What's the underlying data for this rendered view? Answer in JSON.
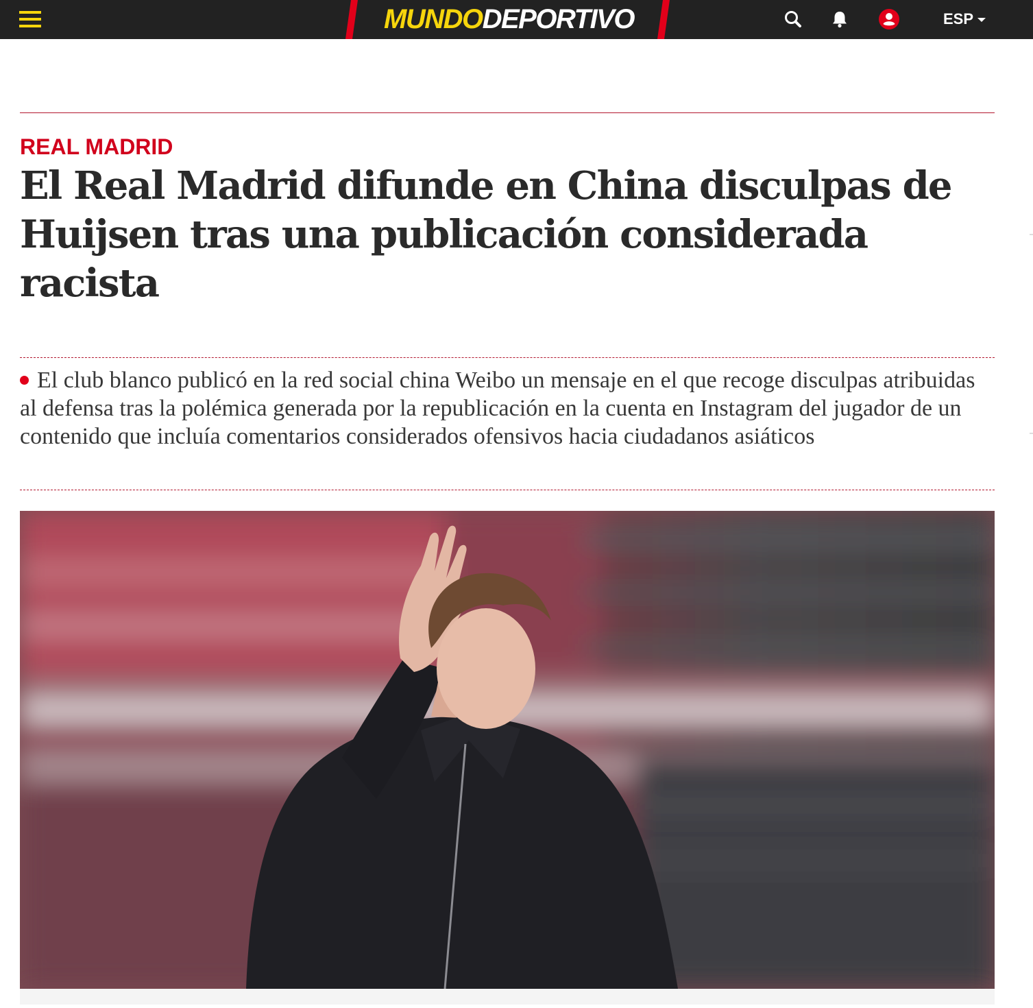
{
  "header": {
    "logo": {
      "part1": "MUNDO",
      "part2": "DEPORTIVO"
    },
    "language": "ESP",
    "icons": [
      "menu-icon",
      "search-icon",
      "bell-icon",
      "user-icon",
      "chevron-down-icon"
    ],
    "colors": {
      "bar": "#222222",
      "logo_yellow": "#f6d50c",
      "brand_red": "#e1001a"
    }
  },
  "article": {
    "section": "REAL MADRID",
    "headline": "El Real Madrid difunde en China disculpas de Huijsen tras una publicación considerada racista",
    "dek": "El club blanco publicó en la red social china Weibo un mensaje en el que recoge disculpas atribuidas al defensa tras la polémica generada por la republicación en la cuenta en Instagram del jugador de un contenido que incluía comentarios considerados ofensivos hacia ciudadanos asiáticos"
  }
}
